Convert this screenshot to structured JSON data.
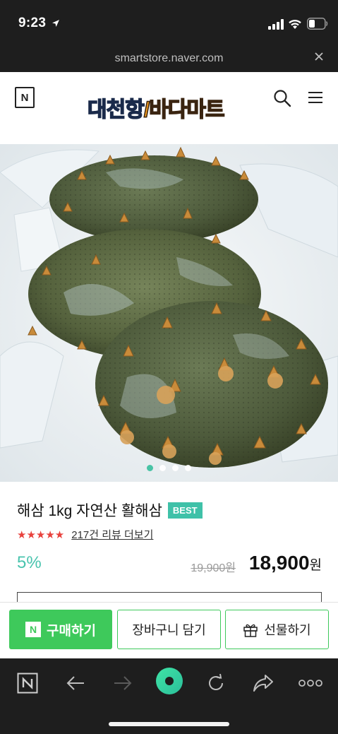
{
  "status_bar": {
    "time": "9:23"
  },
  "browser": {
    "url": "smartstore.naver.com"
  },
  "header": {
    "store_logo_part1": "대천항",
    "store_logo_sep": "/",
    "store_logo_part2": "바다마트",
    "n_logo": "N"
  },
  "carousel": {
    "total_dots": 4,
    "active_index": 0
  },
  "product": {
    "title": "해삼 1kg 자연산 활해삼",
    "badge": "BEST",
    "rating_stars": "★★★★★",
    "rating_value": 5,
    "review_link": "217건 리뷰 더보기",
    "discount": "5%",
    "original_price": "19,900원",
    "sale_price": "18,900",
    "currency": "원"
  },
  "actions": {
    "buy_icon": "N",
    "buy": "구매하기",
    "cart": "장바구니 담기",
    "gift": "선물하기"
  },
  "colors": {
    "accent_green": "#3ec95b",
    "teal": "#3fc1a8",
    "star_red": "#e8413c",
    "dark_bar": "#1e1e1e"
  },
  "icons": [
    "location-arrow-icon",
    "signal-icon",
    "wifi-icon",
    "battery-icon",
    "close-icon",
    "search-icon",
    "menu-icon",
    "star-icon",
    "gift-icon",
    "back-arrow-icon",
    "forward-arrow-icon",
    "refresh-icon",
    "share-icon",
    "more-icon"
  ]
}
